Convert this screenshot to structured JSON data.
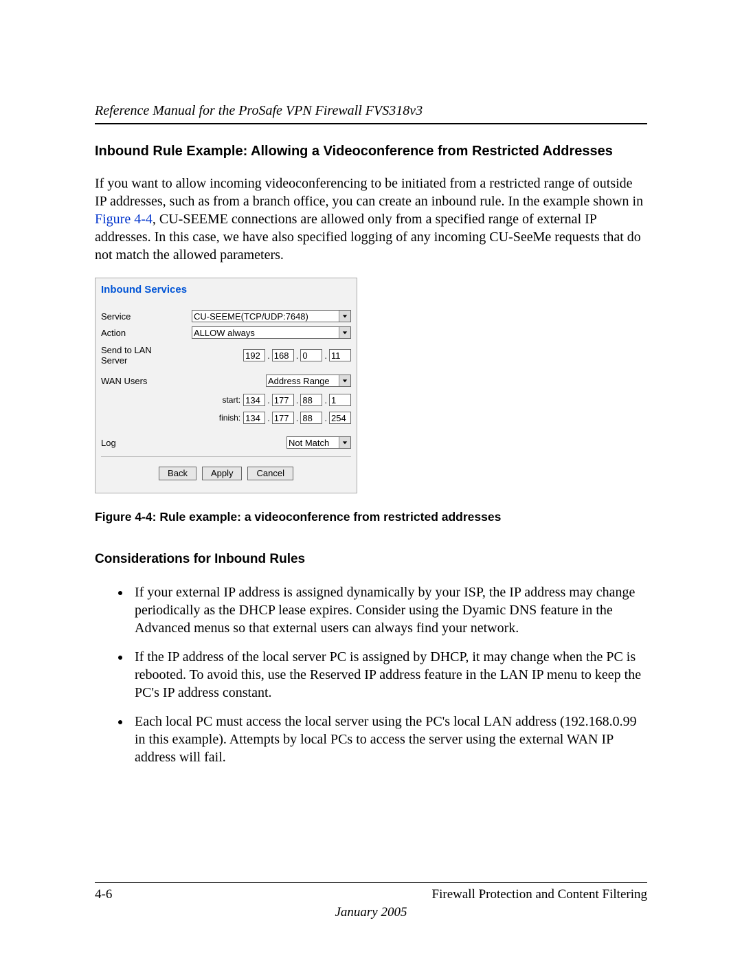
{
  "header": {
    "manual_title": "Reference Manual for the ProSafe VPN Firewall FVS318v3"
  },
  "section": {
    "heading": "Inbound Rule Example: Allowing a Videoconference from Restricted Addresses",
    "para_parts": {
      "p1": "If you want to allow incoming videoconferencing to be initiated from a restricted range of outside IP addresses, such as from a branch office, you can create an inbound rule. In the example shown in ",
      "link": "Figure 4-4",
      "p2": ", CU-SEEME connections are allowed only from a specified range of external IP addresses. In this case, we have also specified logging of any incoming CU-SeeMe requests that do not match the allowed parameters."
    }
  },
  "panel": {
    "title": "Inbound Services",
    "labels": {
      "service": "Service",
      "action": "Action",
      "send_to_lan": "Send to LAN Server",
      "wan_users": "WAN Users",
      "start": "start:",
      "finish": "finish:",
      "log": "Log"
    },
    "values": {
      "service": "CU-SEEME(TCP/UDP:7648)",
      "action": "ALLOW always",
      "lan_ip": [
        "192",
        "168",
        "0",
        "11"
      ],
      "wan_users": "Address Range",
      "start_ip": [
        "134",
        "177",
        "88",
        "1"
      ],
      "finish_ip": [
        "134",
        "177",
        "88",
        "254"
      ],
      "log": "Not Match"
    },
    "buttons": {
      "back": "Back",
      "apply": "Apply",
      "cancel": "Cancel"
    }
  },
  "figure_caption": "Figure 4-4:  Rule example: a videoconference from restricted addresses",
  "considerations": {
    "heading": "Considerations for Inbound Rules",
    "items": [
      "If your external IP address is assigned dynamically by your ISP, the IP address may change periodically as the DHCP lease expires. Consider using the Dyamic DNS feature in the Advanced menus so that external users can always find your network.",
      "If the IP address of the local server PC is assigned by DHCP, it may change when the PC is rebooted. To avoid this, use the Reserved IP address feature in the LAN IP menu to keep the PC's IP address constant.",
      "Each local PC must access the local server using the PC's local LAN address (192.168.0.99 in this example). Attempts by local PCs to access the server using the external WAN IP address will fail."
    ]
  },
  "footer": {
    "page_num": "4-6",
    "section_title": "Firewall Protection and Content Filtering",
    "date": "January 2005"
  }
}
